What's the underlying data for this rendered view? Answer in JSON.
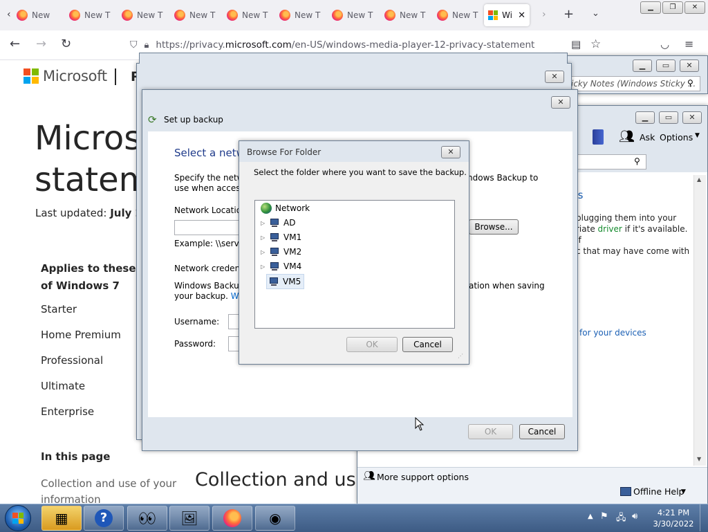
{
  "browser": {
    "tabs": [
      {
        "label": "New T"
      },
      {
        "label": "New T"
      },
      {
        "label": "New T"
      },
      {
        "label": "New T"
      },
      {
        "label": "New T"
      },
      {
        "label": "New T"
      },
      {
        "label": "New T"
      },
      {
        "label": "New T"
      }
    ],
    "active_tab_label": "Wi",
    "url_prefix": "https://privacy.",
    "url_host": "microsoft.com",
    "url_path": "/en-US/windows-media-player-12-privacy-statement"
  },
  "page": {
    "brand": "Microsoft",
    "nav_fragment": "P",
    "title_line1": "Microso",
    "title_line2": "stateme",
    "last_updated_label": "Last updated: ",
    "last_updated_value": "July 20",
    "applies_line1": "Applies to these e",
    "applies_line2": "of Windows 7",
    "editions": [
      "Starter",
      "Home Premium",
      "Professional",
      "Ultimate",
      "Enterprise"
    ],
    "in_this_page": "In this page",
    "toc_first": "Collection and use of your information",
    "section_heading": "Collection and use"
  },
  "help_window": {
    "search_placeholder": "icky Notes (Windows Sticky ...",
    "ask_label": "Ask",
    "options_label": "Options",
    "heading_fragment": "ks",
    "body_lines": [
      "plugging them into your",
      "riate ",
      "driver",
      " if it's available. If",
      "c that may have come with"
    ],
    "devices_link": "for your devices",
    "more_support": "More support options",
    "offline_help": "Offline Help"
  },
  "setup_backup": {
    "title": "Set up backup",
    "heading": "Select a netw",
    "desc_line1": "Specify the netwo",
    "desc_line1_right": "ndows Backup to",
    "desc_line2": "use when accessin",
    "network_location_label": "Network Location",
    "browse_label": "Browse...",
    "example": "Example: \\\\server\\",
    "credentials_label": "Network credenti",
    "cred_desc_line1": "Windows Backup",
    "cred_desc_line1_right": "ation when saving",
    "cred_desc_line2": "your backup. ",
    "cred_link": "Whi",
    "username_label": "Username:",
    "password_label": "Password:",
    "ok_label": "OK",
    "cancel_label": "Cancel"
  },
  "browse_folder": {
    "title": "Browse For Folder",
    "prompt": "Select the folder where you want to save the backup.",
    "tree_root": "Network",
    "tree_items": [
      "AD",
      "VM1",
      "VM2",
      "VM4",
      "VM5"
    ],
    "selected_item": "VM5",
    "ok_label": "OK",
    "cancel_label": "Cancel"
  },
  "taskbar": {
    "time": "4:21 PM",
    "date": "3/30/2022"
  },
  "colors": {
    "ms_red": "#f25022",
    "ms_green": "#7fba00",
    "ms_blue": "#00a4ef",
    "ms_yellow": "#ffb900",
    "link": "#0066cc",
    "dialog_frame": "#dfe6ee"
  }
}
